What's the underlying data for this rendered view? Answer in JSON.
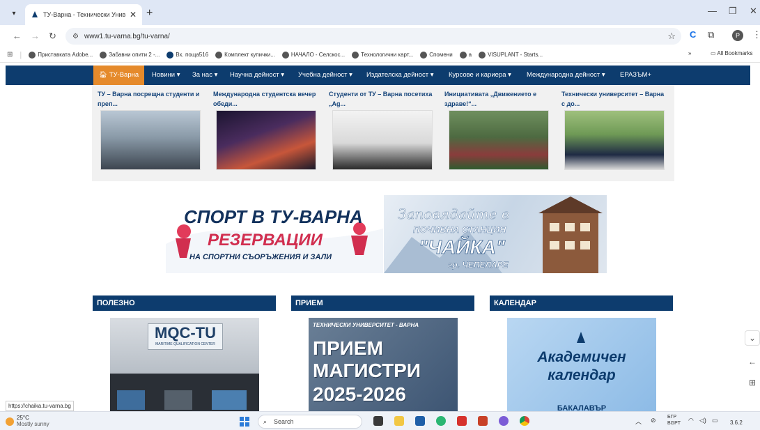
{
  "browser": {
    "tab_title": "ТУ-Варна - Технически Универ...",
    "tab_close": "✕",
    "new_tab": "+",
    "url": "www1.tu-varna.bg/tu-varna/",
    "bookmarks": [
      "Приставката Adobe...",
      "Забавни опити 2 -...",
      "Вх. поща516",
      "Комплект купички...",
      "НАЧАЛО - Селскос...",
      "Технологични карт...",
      "Спомени",
      "a",
      "VISUPLANT - Starts..."
    ],
    "bookmarks_overflow": "»",
    "all_bookmarks": "All Bookmarks",
    "profile_initial": "P"
  },
  "sitenav": {
    "home": "ТУ-Варна",
    "items": [
      "Новини ▾",
      "За нас ▾",
      "Научна дейност ▾",
      "Учебна дейност ▾",
      "Издателска дейност ▾",
      "Курсове и кариера ▾",
      "Международна дейност ▾",
      "ЕРАЗЪМ+"
    ]
  },
  "news": [
    "ТУ – Варна посрещна студенти и преп...",
    "Международна студентска вечер обеди...",
    "Студенти от ТУ – Варна посетиха „Ag...",
    "Инициативата „Движението е здраве!“...",
    "Технически университет – Варна с до..."
  ],
  "banner_sport": {
    "line1": "СПОРТ В ТУ-ВАРНА",
    "line2": "РЕЗЕРВАЦИИ",
    "line3": "НА СПОРТНИ СЪОРЪЖЕНИЯ И ЗАЛИ"
  },
  "banner_chaika": {
    "line1": "Заповядайте в",
    "line2": "ПОЧИВНА СТАНЦИЯ",
    "line3": "\"ЧАЙКА\"",
    "line4": "гр. ЧЕПЕЛАРЕ"
  },
  "sections": {
    "useful": "ПОЛЕЗНО",
    "admission": "ПРИЕМ",
    "calendar": "КАЛЕНДАР"
  },
  "promo_mqc": {
    "title": "MQC-TU",
    "subtitle": "MARITIME QUALIFICATION CENTER"
  },
  "promo_admission": {
    "header": "ТЕХНИЧЕСКИ УНИВЕРСИТЕТ - ВАРНА",
    "line1": "ПРИЕМ",
    "line2": "МАГИСТРИ",
    "line3": "2025-2026"
  },
  "promo_calendar": {
    "line1": "Академичен",
    "line2": "календар",
    "line3": "БАКАЛАВЪР"
  },
  "status_url": "https://chaika.tu-varna.bg",
  "taskbar": {
    "temp": "25°C",
    "condition": "Mostly sunny",
    "search": "Search",
    "lang1": "БГР",
    "lang2": "BGPT",
    "clock": "3.6.2"
  },
  "colors": {
    "nav_blue": "#0d3c6e",
    "accent_orange": "#e58a2b",
    "title_blue": "#15447a"
  }
}
